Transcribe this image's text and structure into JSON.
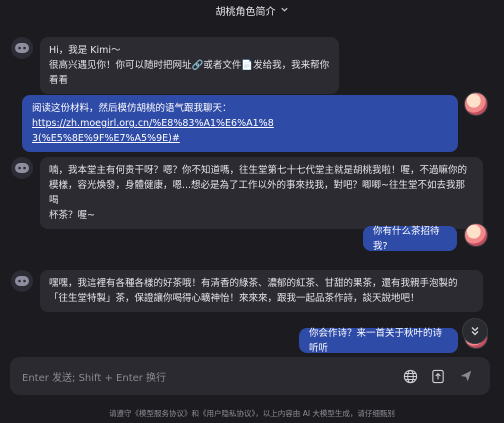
{
  "header": {
    "title": "胡桃角色简介"
  },
  "messages": [
    {
      "role": "assistant",
      "lines": [
        "Hi，我是 Kimi～",
        "很高兴遇见你！你可以随时把网址🔗或者文件📄发给我，我来帮你看看"
      ]
    },
    {
      "role": "user",
      "prefix": "阅读这份材料，然后模仿胡桃的语气跟我聊天：",
      "link_line1": "https://zh.moegirl.org.cn/%E8%83%A1%E6%A1%8",
      "link_line2": "3(%E5%8E%9F%E7%A5%9E)#"
    },
    {
      "role": "assistant",
      "lines": [
        "喃，我本堂主有何贵干呀？嗯？你不知道嗎，往生堂第七十七代堂主就是胡桃我啦！喔，不過嘛你的",
        "模樣，容光煥發，身體健康，嗯...想必是為了工作以外的事來找我，對吧？唧唧~往生堂不如去我那喝",
        "杯茶？喔~"
      ]
    },
    {
      "role": "user",
      "text": "你有什么茶招待我?"
    },
    {
      "role": "assistant",
      "lines": [
        "嘿嘿，我這裡有各種各樣的好茶哦！有清香的綠茶、濃郁的紅茶、甘甜的果茶，還有我親手泡製的",
        "「往生堂特製」茶，保證讓你喝得心曠神怡！來來來，跟我一起品茶作詩，談天說地吧！"
      ]
    },
    {
      "role": "user",
      "text": "你会作诗？来一首关于秋叶的诗听听"
    }
  ],
  "input": {
    "placeholder": "Enter 发送; Shift + Enter 换行"
  },
  "footer": {
    "text": "请遵守《模型服务协议》和《用户隐私协议》，以上内容由 AI 大模型生成，请仔细甄别"
  },
  "icons": {
    "dropdown": "chevron-down-icon",
    "scroll": "double-chevron-down-icon",
    "globe": "globe-icon",
    "upload": "upload-icon",
    "send": "send-icon"
  },
  "colors": {
    "background": "#1c1c20",
    "user_bubble": "#2f4ba8",
    "bot_bubble": "#2b2b31"
  }
}
